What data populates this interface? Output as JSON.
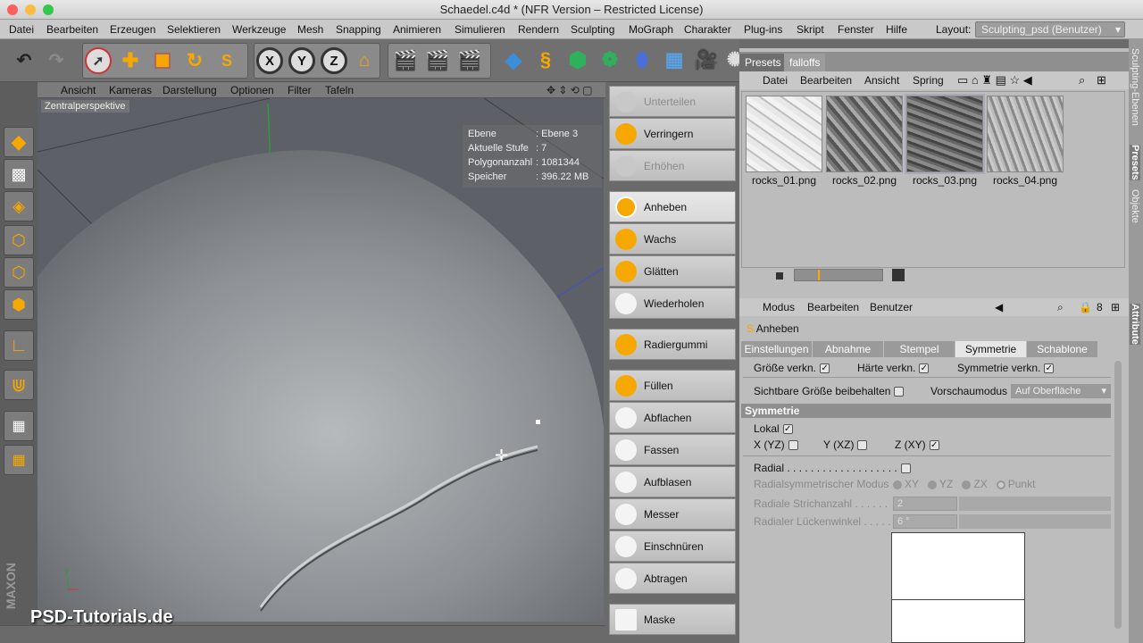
{
  "window": {
    "title": "Schaedel.c4d * (NFR Version – Restricted License)"
  },
  "menubar": {
    "items": [
      "Datei",
      "Bearbeiten",
      "Erzeugen",
      "Selektieren",
      "Werkzeuge",
      "Mesh",
      "Snapping",
      "Animieren",
      "Simulieren",
      "Rendern",
      "Sculpting",
      "MoGraph",
      "Charakter",
      "Plug-ins",
      "Skript",
      "Fenster",
      "Hilfe"
    ],
    "layout_label": "Layout:",
    "layout_value": "Sculpting_psd (Benutzer)"
  },
  "viewport": {
    "menu": [
      "Ansicht",
      "Kameras",
      "Darstellung",
      "Optionen",
      "Filter",
      "Tafeln"
    ],
    "label": "Zentralperspektive",
    "hud": [
      {
        "k": "Ebene",
        "v": ": Ebene 3"
      },
      {
        "k": "Aktuelle Stufe",
        "v": ": 7"
      },
      {
        "k": "Polygonanzahl",
        "v": ": 1081344"
      },
      {
        "k": "Speicher",
        "v": ": 396.22 MB"
      }
    ],
    "watermark": "PSD-Tutorials.de"
  },
  "sculpt": {
    "buttons": [
      "Unterteilen",
      "Verringern",
      "Erhöhen",
      "Anheben",
      "Wachs",
      "Glätten",
      "Wiederholen",
      "Radiergummi",
      "Füllen",
      "Abflachen",
      "Fassen",
      "Aufblasen",
      "Messer",
      "Einschnüren",
      "Abtragen",
      "Maske"
    ],
    "active": "Anheben"
  },
  "presets": {
    "tabs": [
      "Presets",
      "falloffs"
    ],
    "menu": [
      "Datei",
      "Bearbeiten",
      "Ansicht",
      "Spring"
    ],
    "thumbs": [
      "rocks_01.png",
      "rocks_02.png",
      "rocks_03.png",
      "rocks_04.png"
    ]
  },
  "attributes": {
    "menu": [
      "Modus",
      "Bearbeiten",
      "Benutzer"
    ],
    "object": "Anheben",
    "tabs": [
      "Einstellungen",
      "Abnahme",
      "Stempel",
      "Symmetrie",
      "Schablone"
    ],
    "selected_tab": "Symmetrie",
    "row1": [
      "Größe verkn.",
      "Härte verkn.",
      "Symmetrie verkn."
    ],
    "keep_size": "Sichtbare Größe beibehalten",
    "preview_label": "Vorschaumodus",
    "preview_value": "Auf Oberfläche",
    "section": "Symmetrie",
    "lokal": "Lokal",
    "axes": [
      "X (YZ)",
      "Y (XZ)",
      "Z (XY)"
    ],
    "radial": "Radial . . . . . . . . . . . . . . . . . . .",
    "radial_mode": "Radialsymmetrischer Modus",
    "radial_opts": [
      "XY",
      "YZ",
      "ZX",
      "Punkt"
    ],
    "strokes_label": "Radiale Strichanzahl . . . . . .",
    "strokes_val": "2",
    "gap_label": "Radialer Lückenwinkel . . . . . .",
    "gap_val": "6 °"
  },
  "sidetabs": [
    "Sculpting-Ebenen",
    "Presets",
    "Objekte",
    "Attribute"
  ]
}
